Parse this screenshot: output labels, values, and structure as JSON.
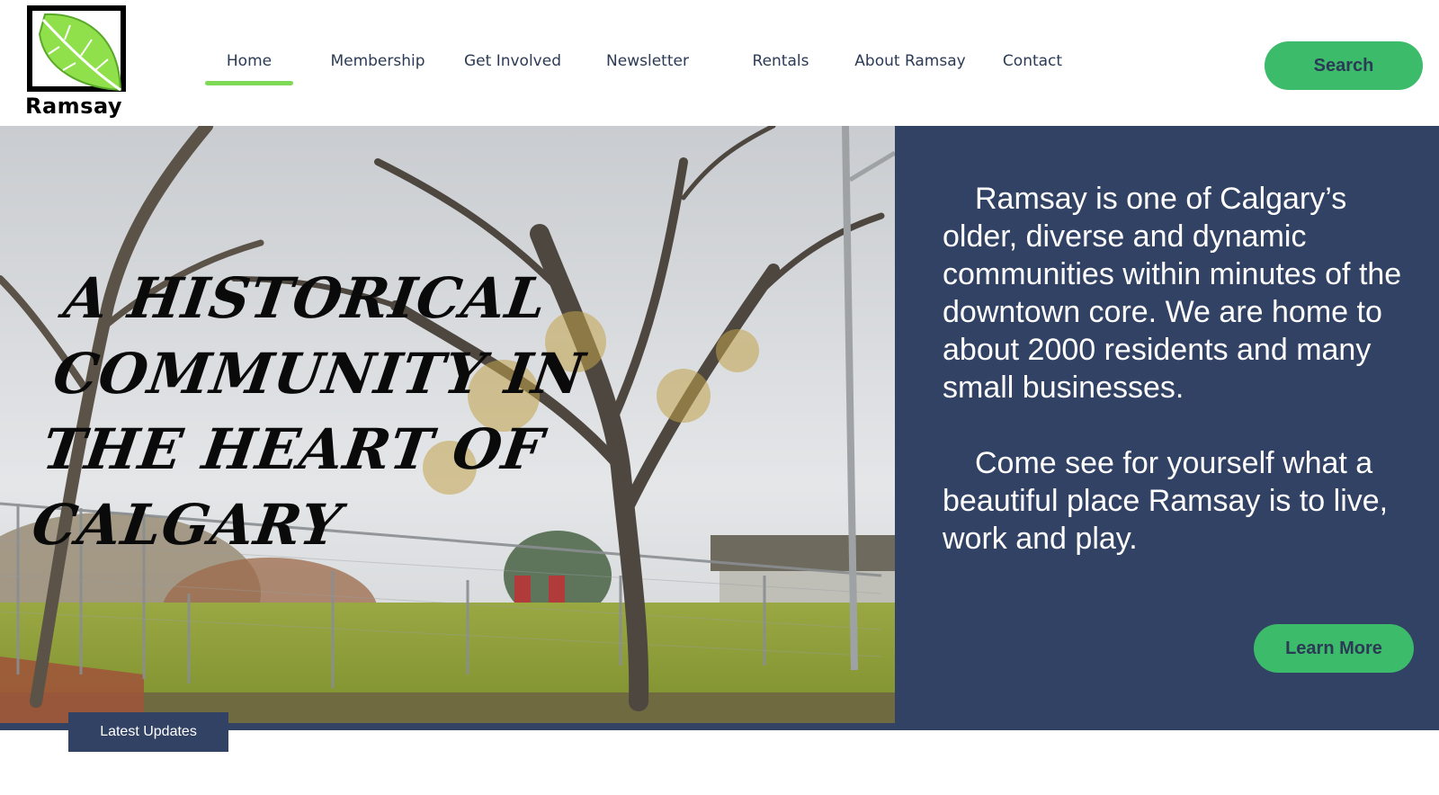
{
  "brand": {
    "logo_text": "Ramsay"
  },
  "nav": {
    "items": [
      {
        "label": "Home",
        "active": true
      },
      {
        "label": "Membership",
        "active": false
      },
      {
        "label": "Get Involved",
        "active": false
      },
      {
        "label": "Newsletter",
        "active": false
      },
      {
        "label": "Rentals",
        "active": false
      },
      {
        "label": "About Ramsay",
        "active": false
      },
      {
        "label": "Contact",
        "active": false
      }
    ],
    "active_color": "#7ed957"
  },
  "header": {
    "search_label": "Search"
  },
  "hero": {
    "headline": "A Historical Community in the Heart of Calgary",
    "paragraphs": [
      "Ramsay is one of Calgary’s older, diverse and dynamic communities within minutes of the downtown core. We are home to about 2000 residents and many small businesses.",
      "Come see for yourself what a beautiful place Ramsay is to live, work and play."
    ],
    "learn_more_label": "Learn More",
    "panel_color": "#324264",
    "button_color": "#3cbb6a"
  },
  "updates": {
    "tab_label": "Latest Updates"
  },
  "icons": {
    "logo": "leaf-logo-icon"
  }
}
